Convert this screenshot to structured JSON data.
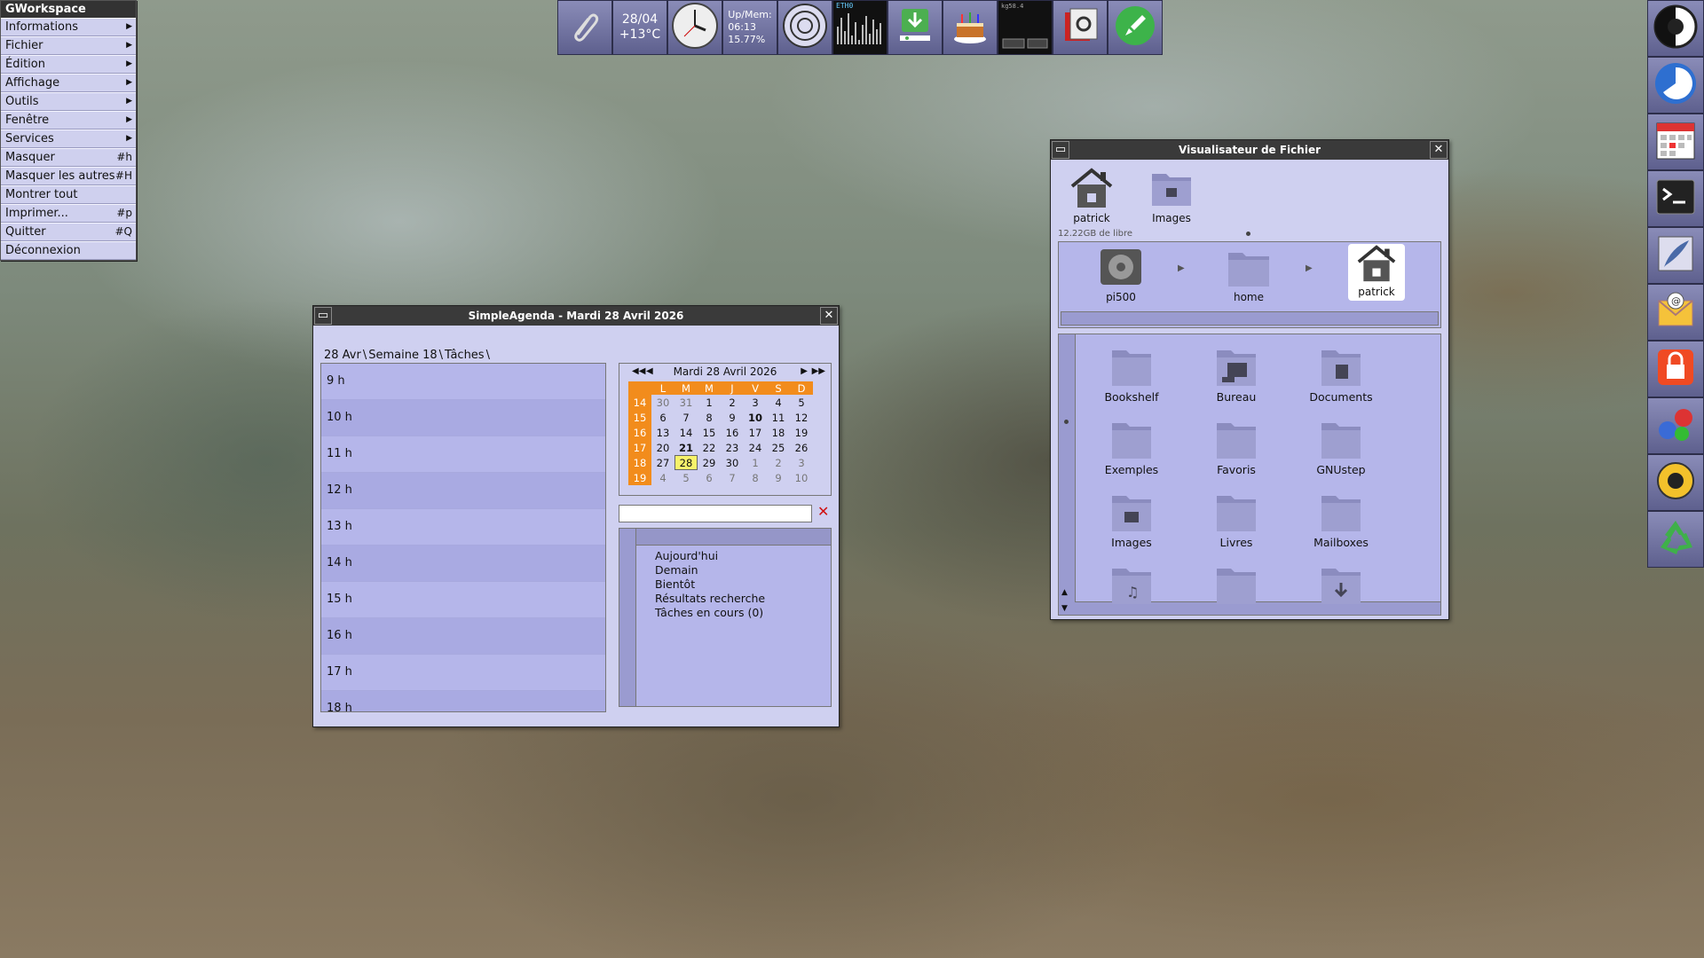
{
  "menu": {
    "title": "GWorkspace",
    "items": [
      {
        "label": "Informations",
        "submenu": true,
        "shortcut": ""
      },
      {
        "label": "Fichier",
        "submenu": true,
        "shortcut": ""
      },
      {
        "label": "Édition",
        "submenu": true,
        "shortcut": ""
      },
      {
        "label": "Affichage",
        "submenu": true,
        "shortcut": ""
      },
      {
        "label": "Outils",
        "submenu": true,
        "shortcut": ""
      },
      {
        "label": "Fenêtre",
        "submenu": true,
        "shortcut": ""
      },
      {
        "label": "Services",
        "submenu": true,
        "shortcut": ""
      },
      {
        "label": "Masquer",
        "submenu": false,
        "shortcut": "#h"
      },
      {
        "label": "Masquer les autres",
        "submenu": false,
        "shortcut": "#H"
      },
      {
        "label": "Montrer tout",
        "submenu": false,
        "shortcut": ""
      },
      {
        "label": "Imprimer...",
        "submenu": false,
        "shortcut": "#p"
      },
      {
        "label": "Quitter",
        "submenu": false,
        "shortcut": "#Q"
      },
      {
        "label": "Déconnexion",
        "submenu": false,
        "shortcut": ""
      }
    ]
  },
  "topdock": {
    "date": "28/04",
    "temp": "+13°C",
    "upmem_label": "Up/Mem:",
    "uptime": "06:13",
    "mem": "15.77%",
    "net_label": "ETH0",
    "monitor_label": "kg58.4"
  },
  "agenda": {
    "title": "SimpleAgenda - Mardi 28 Avril 2026",
    "tabs": [
      "28 Avr",
      "Semaine 18",
      "Tâches"
    ],
    "hours": [
      "9 h",
      "10 h",
      "11 h",
      "12 h",
      "13 h",
      "14 h",
      "15 h",
      "16 h",
      "17 h",
      "18 h"
    ],
    "calendar": {
      "header": "Mardi 28 Avril 2026",
      "weekdays": [
        "L",
        "M",
        "M",
        "J",
        "V",
        "S",
        "D"
      ],
      "weeks": [
        {
          "num": "14",
          "days": [
            "30",
            "31",
            "1",
            "2",
            "3",
            "4",
            "5"
          ]
        },
        {
          "num": "15",
          "days": [
            "6",
            "7",
            "8",
            "9",
            "10",
            "11",
            "12"
          ]
        },
        {
          "num": "16",
          "days": [
            "13",
            "14",
            "15",
            "16",
            "17",
            "18",
            "19"
          ]
        },
        {
          "num": "17",
          "days": [
            "20",
            "21",
            "22",
            "23",
            "24",
            "25",
            "26"
          ]
        },
        {
          "num": "18",
          "days": [
            "27",
            "28",
            "29",
            "30",
            "1",
            "2",
            "3"
          ]
        },
        {
          "num": "19",
          "days": [
            "4",
            "5",
            "6",
            "7",
            "8",
            "9",
            "10"
          ]
        }
      ]
    },
    "search_value": "",
    "task_lists": [
      "Aujourd'hui",
      "Demain",
      "Bientôt",
      "Résultats recherche",
      "Tâches en cours (0)"
    ]
  },
  "fileviewer": {
    "title": "Visualisateur de Fichier",
    "shelf": [
      {
        "label": "patrick",
        "icon": "home-icon"
      },
      {
        "label": "Images",
        "icon": "images-folder-icon"
      }
    ],
    "free_space": "12.22GB de libre",
    "path": [
      "pi500",
      "home",
      "patrick"
    ],
    "files": [
      "Bookshelf",
      "Bureau",
      "Documents",
      "Exemples",
      "Favoris",
      "GNUstep",
      "Images",
      "Livres",
      "Mailboxes"
    ]
  },
  "colors": {
    "accent_orange": "#f28c1c",
    "today_yellow": "#f7f26b",
    "panel_lavender": "#cfd0f0"
  }
}
